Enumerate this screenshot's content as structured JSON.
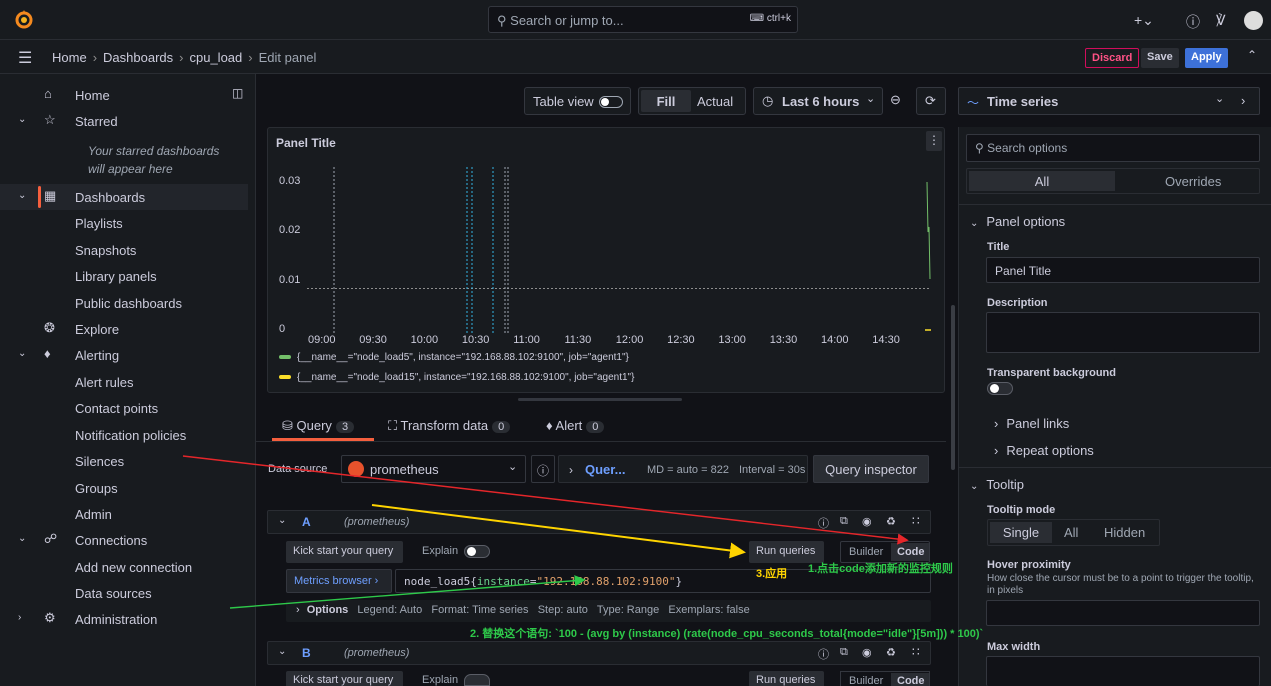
{
  "topbar": {
    "search_placeholder": "Search or jump to...",
    "shortcut": "ctrl+k"
  },
  "breadcrumb": {
    "items": [
      "Home",
      "Dashboards",
      "cpu_load"
    ],
    "current": "Edit panel"
  },
  "actions": {
    "discard": "Discard",
    "save": "Save",
    "apply": "Apply"
  },
  "sidebar": {
    "home": "Home",
    "starred": "Starred",
    "starred_note": "Your starred dashboards will appear here",
    "dashboards": "Dashboards",
    "playlists": "Playlists",
    "snapshots": "Snapshots",
    "library_panels": "Library panels",
    "public_dashboards": "Public dashboards",
    "explore": "Explore",
    "alerting": "Alerting",
    "alert_rules": "Alert rules",
    "contact_points": "Contact points",
    "notification_policies": "Notification policies",
    "silences": "Silences",
    "groups": "Groups",
    "admin": "Admin",
    "connections": "Connections",
    "add_new_connection": "Add new connection",
    "data_sources": "Data sources",
    "administration": "Administration"
  },
  "panel_toolbar": {
    "table_view": "Table view",
    "fill": "Fill",
    "actual": "Actual",
    "time_range": "Last 6 hours"
  },
  "panel": {
    "title": "Panel Title"
  },
  "chart_data": {
    "type": "line",
    "title": "Panel Title",
    "y_ticks": [
      "0.03",
      "0.02",
      "0.01",
      "0"
    ],
    "x_ticks": [
      "09:00",
      "09:30",
      "10:00",
      "10:30",
      "11:00",
      "11:30",
      "12:00",
      "12:30",
      "13:00",
      "13:30",
      "14:00",
      "14:30"
    ],
    "ylim": [
      0,
      0.03
    ],
    "series": [
      {
        "name": "{__name__=\"node_load5\", instance=\"192.168.88.102:9100\", job=\"agent1\"}",
        "color": "#73bf69"
      },
      {
        "name": "{__name__=\"node_load15\", instance=\"192.168.88.102:9100\", job=\"agent1\"}",
        "color": "#fade2a"
      }
    ]
  },
  "query_tabs": {
    "query": "Query",
    "query_count": "3",
    "transform": "Transform data",
    "transform_count": "0",
    "alert": "Alert",
    "alert_count": "0"
  },
  "datasource": {
    "label": "Data source",
    "name": "prometheus",
    "query_options": "Quer...",
    "md": "MD = auto = 822",
    "interval": "Interval = 30s",
    "inspector": "Query inspector"
  },
  "query_a": {
    "letter": "A",
    "ds": "(prometheus)",
    "kick_start": "Kick start your query",
    "explain": "Explain",
    "run": "Run queries",
    "builder": "Builder",
    "code": "Code",
    "metrics_browser": "Metrics browser ›",
    "expr_metric": "node_load5",
    "expr_open": "{",
    "expr_key": "instance",
    "expr_eq": "=",
    "expr_val": "\"192.168.88.102:9100\"",
    "expr_close": "}",
    "options": "Options",
    "options_summary": "Legend: Auto   Format: Time series   Step: auto   Type: Range   Exemplars: false"
  },
  "query_b": {
    "letter": "B",
    "ds": "(prometheus)",
    "kick_start": "Kick start your query",
    "explain": "Explain",
    "run": "Run queries",
    "builder": "Builder",
    "code": "Code"
  },
  "annotations": {
    "step1": "1.点击code添加新的监控规则",
    "step2": "2. 替换这个语句: `100 - (avg by (instance) (rate(node_cpu_seconds_total{mode=\"idle\"}[5m])) * 100)`",
    "step3": "3.应用"
  },
  "options_pane": {
    "viz": "Time series",
    "search_placeholder": "Search options",
    "all": "All",
    "overrides": "Overrides",
    "panel_options": "Panel options",
    "title_label": "Title",
    "title_value": "Panel Title",
    "description_label": "Description",
    "transparent_label": "Transparent background",
    "panel_links": "Panel links",
    "repeat_options": "Repeat options",
    "tooltip": "Tooltip",
    "tooltip_mode": "Tooltip mode",
    "mode_single": "Single",
    "mode_all": "All",
    "mode_hidden": "Hidden",
    "hover_proximity": "Hover proximity",
    "hover_desc": "How close the cursor must be to a point to trigger the tooltip, in pixels",
    "max_width": "Max width"
  },
  "colors": {
    "accent": "#f55f3e",
    "primary": "#3d71d9",
    "discard": "#d10e5c"
  }
}
